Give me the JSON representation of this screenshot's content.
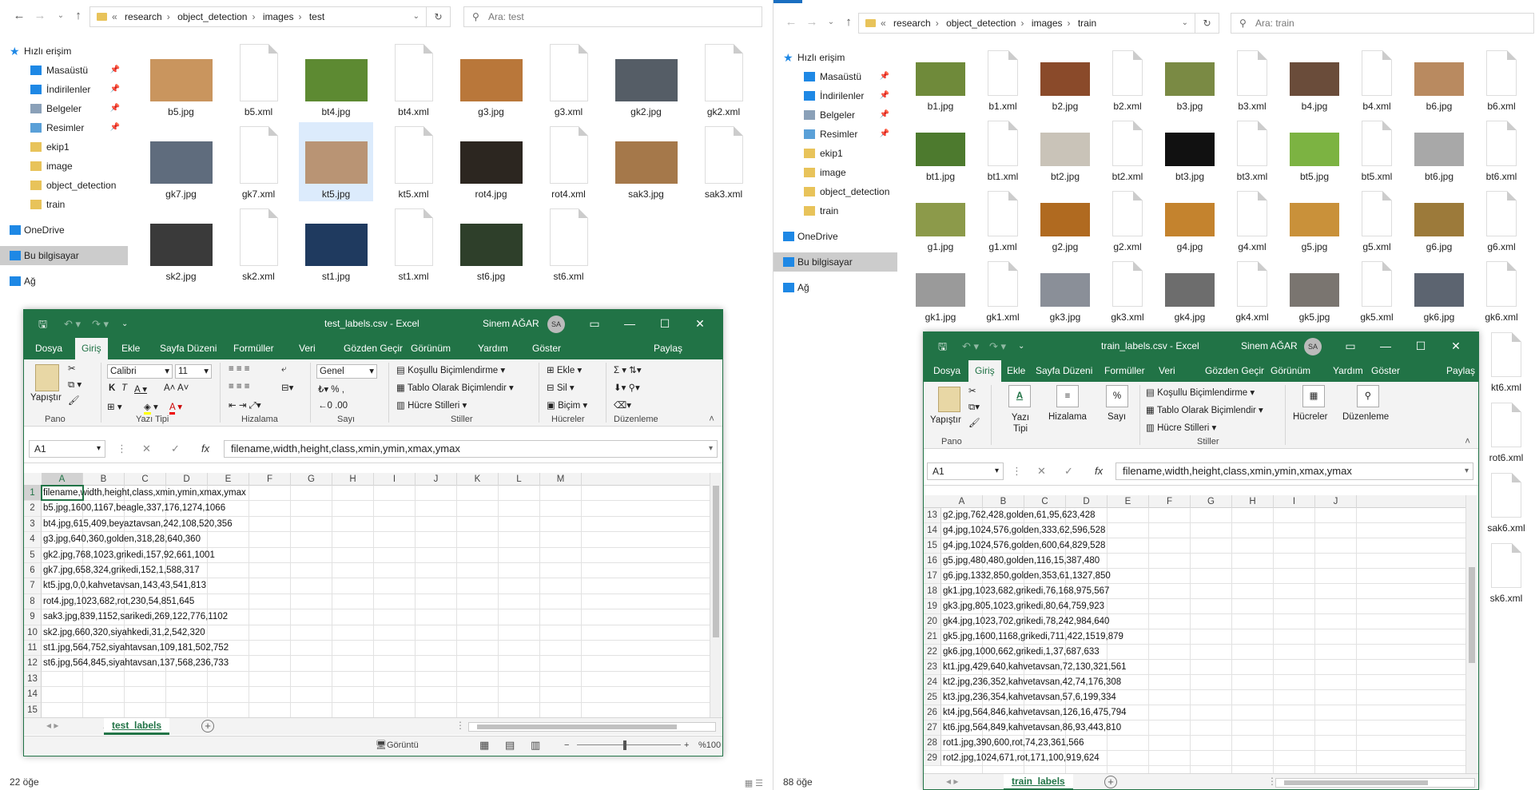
{
  "left_explorer": {
    "path": [
      "research",
      "object_detection",
      "images",
      "test"
    ],
    "search_placeholder": "Ara: test",
    "status": "22 öğe",
    "sidebar": [
      {
        "label": "Hızlı erişim",
        "kind": "top",
        "icon": "star-icon"
      },
      {
        "label": "Masaüstü",
        "kind": "sub",
        "icon": "desktop-icon",
        "pinned": true
      },
      {
        "label": "İndirilenler",
        "kind": "sub",
        "icon": "download-icon",
        "pinned": true
      },
      {
        "label": "Belgeler",
        "kind": "sub",
        "icon": "documents-icon",
        "pinned": true
      },
      {
        "label": "Resimler",
        "kind": "sub",
        "icon": "pictures-icon",
        "pinned": true
      },
      {
        "label": "ekip1",
        "kind": "sub",
        "icon": "folder-icon"
      },
      {
        "label": "image",
        "kind": "sub",
        "icon": "folder-icon"
      },
      {
        "label": "object_detection",
        "kind": "sub",
        "icon": "folder-icon"
      },
      {
        "label": "train",
        "kind": "sub",
        "icon": "folder-icon"
      },
      {
        "label": "OneDrive",
        "kind": "top",
        "icon": "cloud-icon"
      },
      {
        "label": "Bu bilgisayar",
        "kind": "top",
        "icon": "computer-icon",
        "selected": true
      },
      {
        "label": "Ağ",
        "kind": "top",
        "icon": "network-icon"
      }
    ],
    "files": [
      {
        "name": "b5.jpg",
        "type": "img",
        "color": "#c9955e"
      },
      {
        "name": "b5.xml",
        "type": "xml"
      },
      {
        "name": "bt4.jpg",
        "type": "img",
        "color": "#5d8a32"
      },
      {
        "name": "bt4.xml",
        "type": "xml"
      },
      {
        "name": "g3.jpg",
        "type": "img",
        "color": "#b9773a"
      },
      {
        "name": "g3.xml",
        "type": "xml"
      },
      {
        "name": "gk2.jpg",
        "type": "img",
        "color": "#555d66"
      },
      {
        "name": "gk2.xml",
        "type": "xml"
      },
      {
        "name": "gk7.jpg",
        "type": "img",
        "color": "#5f6c7d"
      },
      {
        "name": "gk7.xml",
        "type": "xml"
      },
      {
        "name": "kt5.jpg",
        "type": "img",
        "color": "#b99474",
        "selected": true
      },
      {
        "name": "kt5.xml",
        "type": "xml"
      },
      {
        "name": "rot4.jpg",
        "type": "img",
        "color": "#2c2620"
      },
      {
        "name": "rot4.xml",
        "type": "xml"
      },
      {
        "name": "sak3.jpg",
        "type": "img",
        "color": "#a5784a"
      },
      {
        "name": "sak3.xml",
        "type": "xml"
      },
      {
        "name": "sk2.jpg",
        "type": "img",
        "color": "#3a3a3a"
      },
      {
        "name": "sk2.xml",
        "type": "xml"
      },
      {
        "name": "st1.jpg",
        "type": "img",
        "color": "#1f3a5f"
      },
      {
        "name": "st1.xml",
        "type": "xml"
      },
      {
        "name": "st6.jpg",
        "type": "img",
        "color": "#2e3f2a"
      },
      {
        "name": "st6.xml",
        "type": "xml"
      }
    ]
  },
  "right_explorer": {
    "path": [
      "research",
      "object_detection",
      "images",
      "train"
    ],
    "search_placeholder": "Ara: train",
    "status": "88 öğe",
    "sidebar": [
      {
        "label": "Hızlı erişim",
        "kind": "top",
        "icon": "star-icon"
      },
      {
        "label": "Masaüstü",
        "kind": "sub",
        "icon": "desktop-icon",
        "pinned": true
      },
      {
        "label": "İndirilenler",
        "kind": "sub",
        "icon": "download-icon",
        "pinned": true
      },
      {
        "label": "Belgeler",
        "kind": "sub",
        "icon": "documents-icon",
        "pinned": true
      },
      {
        "label": "Resimler",
        "kind": "sub",
        "icon": "pictures-icon",
        "pinned": true
      },
      {
        "label": "ekip1",
        "kind": "sub",
        "icon": "folder-icon"
      },
      {
        "label": "image",
        "kind": "sub",
        "icon": "folder-icon"
      },
      {
        "label": "object_detection",
        "kind": "sub",
        "icon": "folder-icon"
      },
      {
        "label": "train",
        "kind": "sub",
        "icon": "folder-icon"
      },
      {
        "label": "OneDrive",
        "kind": "top",
        "icon": "cloud-icon"
      },
      {
        "label": "Bu bilgisayar",
        "kind": "top",
        "icon": "computer-icon",
        "selected": true
      },
      {
        "label": "Ağ",
        "kind": "top",
        "icon": "network-icon"
      }
    ],
    "files": [
      {
        "name": "b1.jpg",
        "type": "img",
        "color": "#6f8a3a"
      },
      {
        "name": "b1.xml",
        "type": "xml"
      },
      {
        "name": "b2.jpg",
        "type": "img",
        "color": "#8a4a2a"
      },
      {
        "name": "b2.xml",
        "type": "xml"
      },
      {
        "name": "b3.jpg",
        "type": "img",
        "color": "#7a8a44"
      },
      {
        "name": "b3.xml",
        "type": "xml"
      },
      {
        "name": "b4.jpg",
        "type": "img",
        "color": "#6a4c3a"
      },
      {
        "name": "b4.xml",
        "type": "xml"
      },
      {
        "name": "b6.jpg",
        "type": "img",
        "color": "#b98a60"
      },
      {
        "name": "b6.xml",
        "type": "xml"
      },
      {
        "name": "bt1.jpg",
        "type": "img",
        "color": "#4d7a2e"
      },
      {
        "name": "bt1.xml",
        "type": "xml"
      },
      {
        "name": "bt2.jpg",
        "type": "img",
        "color": "#c9c3b8"
      },
      {
        "name": "bt2.xml",
        "type": "xml"
      },
      {
        "name": "bt3.jpg",
        "type": "img",
        "color": "#111111"
      },
      {
        "name": "bt3.xml",
        "type": "xml"
      },
      {
        "name": "bt5.jpg",
        "type": "img",
        "color": "#7cb342"
      },
      {
        "name": "bt5.xml",
        "type": "xml"
      },
      {
        "name": "bt6.jpg",
        "type": "img",
        "color": "#a8a8a8"
      },
      {
        "name": "bt6.xml",
        "type": "xml"
      },
      {
        "name": "g1.jpg",
        "type": "img",
        "color": "#8c9a4a"
      },
      {
        "name": "g1.xml",
        "type": "xml"
      },
      {
        "name": "g2.jpg",
        "type": "img",
        "color": "#b06a20"
      },
      {
        "name": "g2.xml",
        "type": "xml"
      },
      {
        "name": "g4.jpg",
        "type": "img",
        "color": "#c4832e"
      },
      {
        "name": "g4.xml",
        "type": "xml"
      },
      {
        "name": "g5.jpg",
        "type": "img",
        "color": "#c9913a"
      },
      {
        "name": "g5.xml",
        "type": "xml"
      },
      {
        "name": "g6.jpg",
        "type": "img",
        "color": "#9c7a3a"
      },
      {
        "name": "g6.xml",
        "type": "xml"
      },
      {
        "name": "gk1.jpg",
        "type": "img",
        "color": "#9a9a9a"
      },
      {
        "name": "gk1.xml",
        "type": "xml"
      },
      {
        "name": "gk3.jpg",
        "type": "img",
        "color": "#8a8f98"
      },
      {
        "name": "gk3.xml",
        "type": "xml"
      },
      {
        "name": "gk4.jpg",
        "type": "img",
        "color": "#6d6d6d"
      },
      {
        "name": "gk4.xml",
        "type": "xml"
      },
      {
        "name": "gk5.jpg",
        "type": "img",
        "color": "#7a7570"
      },
      {
        "name": "gk5.xml",
        "type": "xml"
      },
      {
        "name": "gk6.jpg",
        "type": "img",
        "color": "#5c6470"
      },
      {
        "name": "gk6.xml",
        "type": "xml"
      }
    ],
    "extra_files": [
      "kt6.xml",
      "rot6.xml",
      "sak6.xml",
      "sk6.xml"
    ]
  },
  "excel_left": {
    "title": "test_labels.csv  -  Excel",
    "user": "Sinem AĞAR",
    "initials": "SA",
    "tabs": [
      "Dosya",
      "Giriş",
      "Ekle",
      "Sayfa Düzeni",
      "Formüller",
      "Veri",
      "Gözden Geçir",
      "Görünüm",
      "Yardım",
      "Göster",
      "Paylaş"
    ],
    "ribbon": {
      "paste": "Yapıştır",
      "font": "Calibri",
      "size": "11",
      "format": "Genel",
      "cond": "Koşullu Biçimlendirme",
      "table": "Tablo Olarak Biçimlendir",
      "styles": "Hücre Stilleri",
      "insert": "Ekle",
      "delete": "Sil",
      "formatc": "Biçim",
      "groups": [
        "Pano",
        "Yazı Tipi",
        "Hizalama",
        "Sayı",
        "Stiller",
        "Hücreler",
        "Düzenleme"
      ]
    },
    "namebox": "A1",
    "formula": "filename,width,height,class,xmin,ymin,xmax,ymax",
    "columns": [
      "A",
      "B",
      "C",
      "D",
      "E",
      "F",
      "G",
      "H",
      "I",
      "J",
      "K",
      "L",
      "M"
    ],
    "rows": [
      {
        "n": "1",
        "v": "filename,width,height,class,xmin,ymin,xmax,ymax"
      },
      {
        "n": "2",
        "v": "b5.jpg,1600,1167,beagle,337,176,1274,1066"
      },
      {
        "n": "3",
        "v": "bt4.jpg,615,409,beyaztavsan,242,108,520,356"
      },
      {
        "n": "4",
        "v": "g3.jpg,640,360,golden,318,28,640,360"
      },
      {
        "n": "5",
        "v": "gk2.jpg,768,1023,grikedi,157,92,661,1001"
      },
      {
        "n": "6",
        "v": "gk7.jpg,658,324,grikedi,152,1,588,317"
      },
      {
        "n": "7",
        "v": "kt5.jpg,0,0,kahvetavsan,143,43,541,813"
      },
      {
        "n": "8",
        "v": "rot4.jpg,1023,682,rot,230,54,851,645"
      },
      {
        "n": "9",
        "v": "sak3.jpg,839,1152,sarikedi,269,122,776,1102"
      },
      {
        "n": "10",
        "v": "sk2.jpg,660,320,siyahkedi,31,2,542,320"
      },
      {
        "n": "11",
        "v": "st1.jpg,564,752,siyahtavsan,109,181,502,752"
      },
      {
        "n": "12",
        "v": "st6.jpg,564,845,siyahtavsan,137,568,236,733"
      },
      {
        "n": "13",
        "v": ""
      },
      {
        "n": "14",
        "v": ""
      },
      {
        "n": "15",
        "v": ""
      }
    ],
    "sheet_tab": "test_labels",
    "status_view": "Görüntü Ayarları",
    "zoom": "%100"
  },
  "excel_right": {
    "title": "train_labels.csv  -  Excel",
    "user": "Sinem AĞAR",
    "initials": "SA",
    "tabs": [
      "Dosya",
      "Giriş",
      "Ekle",
      "Sayfa Düzeni",
      "Formüller",
      "Veri",
      "Gözden Geçir",
      "Görünüm",
      "Yardım",
      "Göster",
      "Paylaş"
    ],
    "ribbon": {
      "paste": "Yapıştır",
      "font": "Yazı Tipi",
      "align": "Hizalama",
      "number": "Sayı",
      "cond": "Koşullu Biçimlendirme",
      "table": "Tablo Olarak Biçimlendir",
      "styles": "Hücre Stilleri",
      "cells": "Hücreler",
      "editing": "Düzenleme",
      "groups": [
        "Pano",
        "Stiller"
      ]
    },
    "namebox": "A1",
    "formula": "filename,width,height,class,xmin,ymin,xmax,ymax",
    "columns": [
      "A",
      "B",
      "C",
      "D",
      "E",
      "F",
      "G",
      "H",
      "I",
      "J"
    ],
    "rows": [
      {
        "n": "13",
        "v": "g2.jpg,762,428,golden,61,95,623,428"
      },
      {
        "n": "14",
        "v": "g4.jpg,1024,576,golden,333,62,596,528"
      },
      {
        "n": "15",
        "v": "g4.jpg,1024,576,golden,600,64,829,528"
      },
      {
        "n": "16",
        "v": "g5.jpg,480,480,golden,116,15,387,480"
      },
      {
        "n": "17",
        "v": "g6.jpg,1332,850,golden,353,61,1327,850"
      },
      {
        "n": "18",
        "v": "gk1.jpg,1023,682,grikedi,76,168,975,567"
      },
      {
        "n": "19",
        "v": "gk3.jpg,805,1023,grikedi,80,64,759,923"
      },
      {
        "n": "20",
        "v": "gk4.jpg,1023,702,grikedi,78,242,984,640"
      },
      {
        "n": "21",
        "v": "gk5.jpg,1600,1168,grikedi,711,422,1519,879"
      },
      {
        "n": "22",
        "v": "gk6.jpg,1000,662,grikedi,1,37,687,633"
      },
      {
        "n": "23",
        "v": "kt1.jpg,429,640,kahvetavsan,72,130,321,561"
      },
      {
        "n": "24",
        "v": "kt2.jpg,236,352,kahvetavsan,42,74,176,308"
      },
      {
        "n": "25",
        "v": "kt3.jpg,236,354,kahvetavsan,57,6,199,334"
      },
      {
        "n": "26",
        "v": "kt4.jpg,564,846,kahvetavsan,126,16,475,794"
      },
      {
        "n": "27",
        "v": "kt6.jpg,564,849,kahvetavsan,86,93,443,810"
      },
      {
        "n": "28",
        "v": "rot1.jpg,390,600,rot,74,23,361,566"
      },
      {
        "n": "29",
        "v": "rot2.jpg,1024,671,rot,171,100,919,624"
      }
    ],
    "sheet_tab": "train_labels"
  }
}
